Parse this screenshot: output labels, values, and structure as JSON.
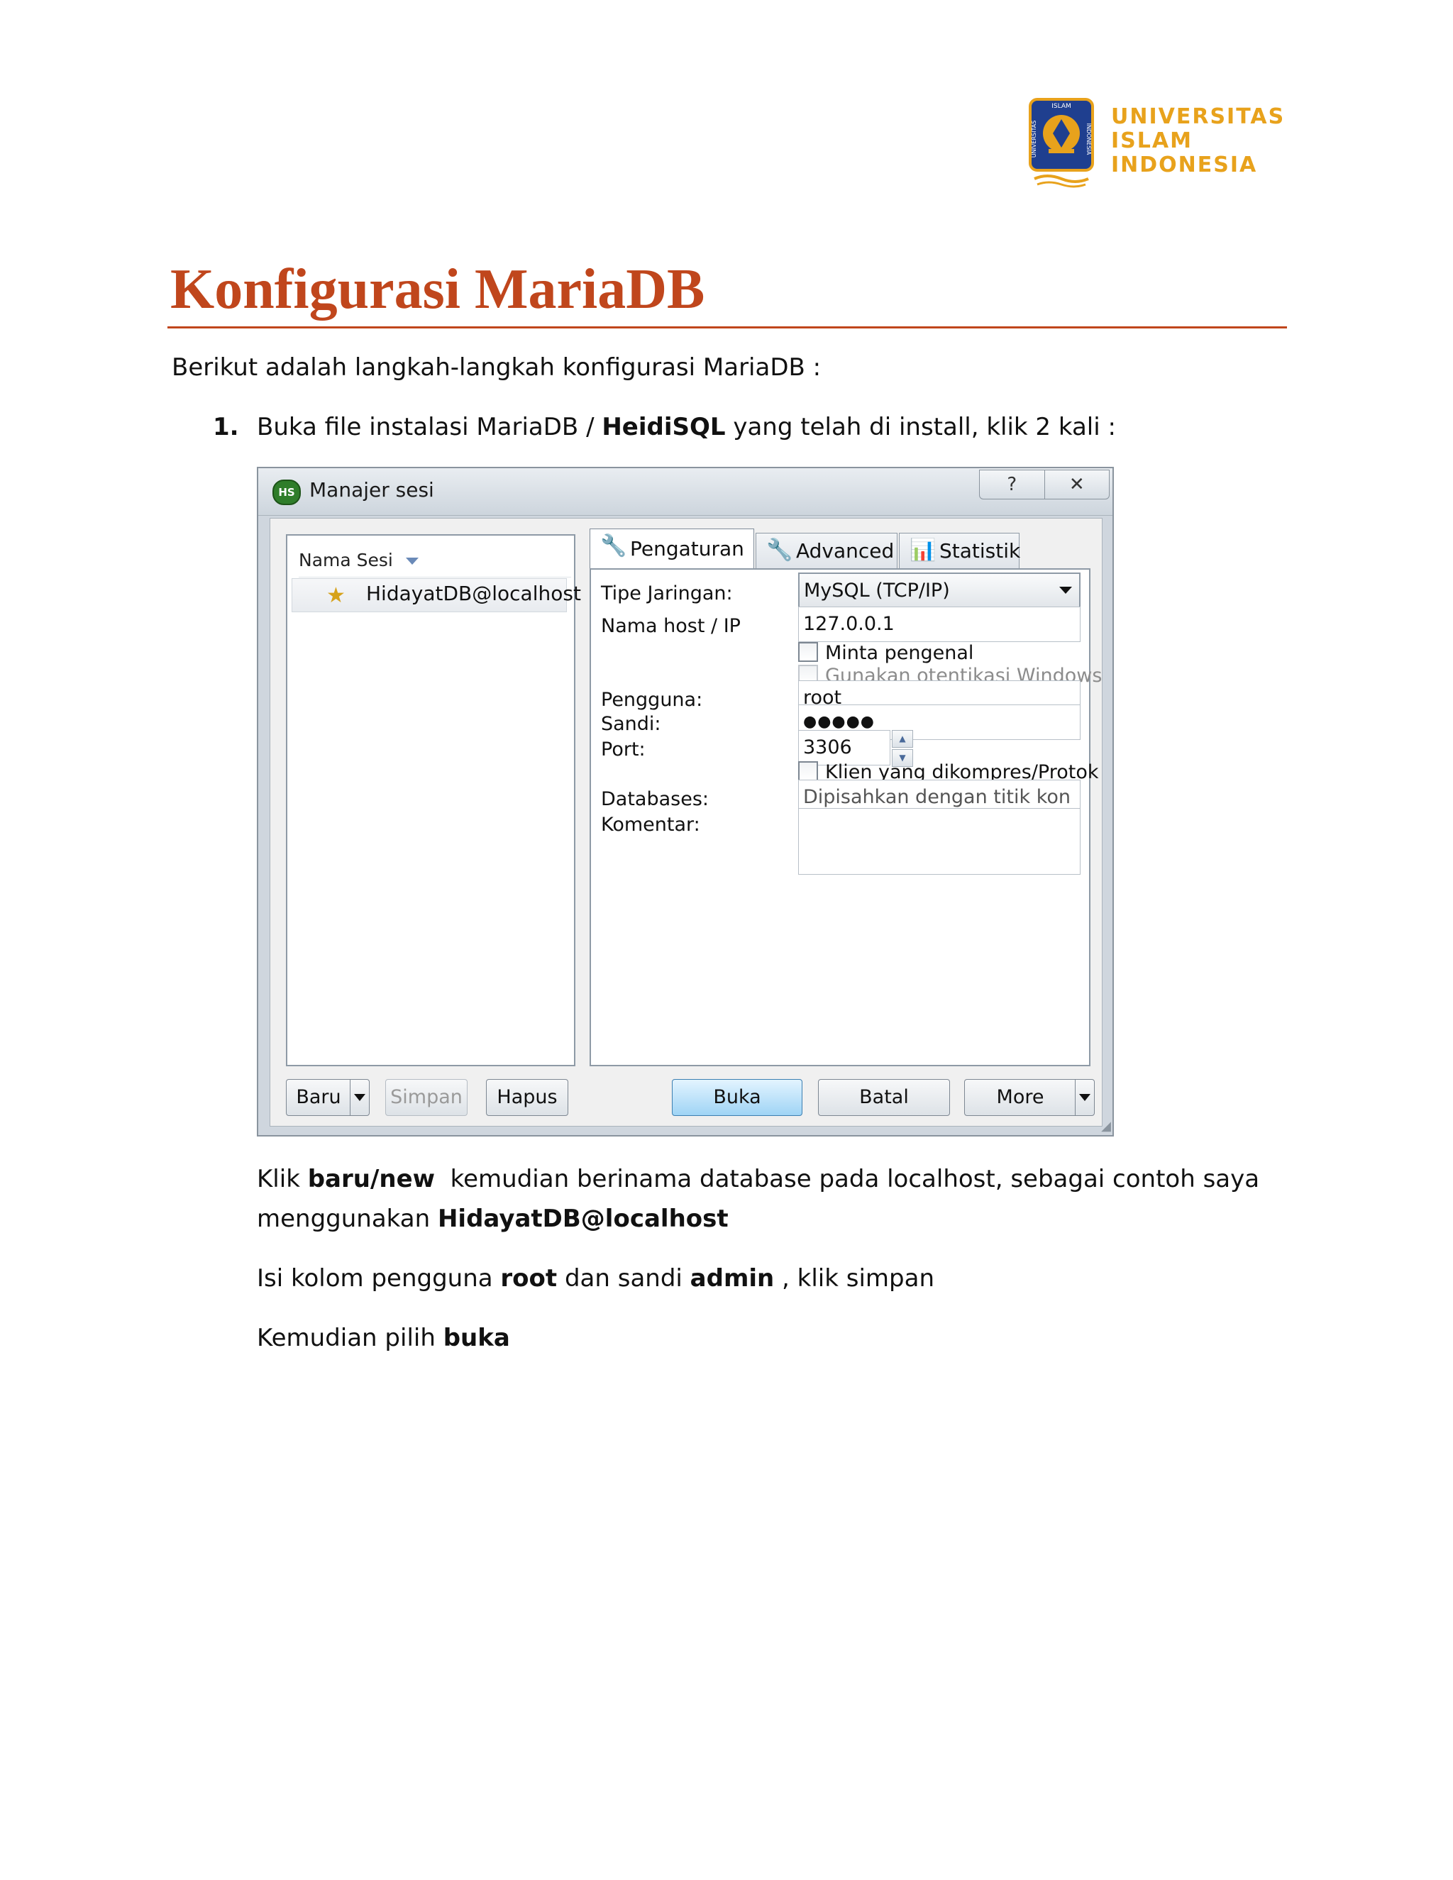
{
  "logo": {
    "line1": "UNIVERSITAS",
    "line2": "ISLAM",
    "line3": "INDONESIA",
    "emblem_text_top": "ISLAM",
    "emblem_text_left": "UNIVERSITAS",
    "emblem_text_right": "INDONESIA",
    "color": "#e8a21c",
    "emblem_color": "#1f3f8f"
  },
  "heading": {
    "title": "Konfigurasi MariaDB",
    "color": "#c0461c"
  },
  "intro": "Berikut adalah langkah-langkah konfigurasi MariaDB :",
  "step1": {
    "number": "1.",
    "text_before": "Buka file instalasi MariaDB / ",
    "bold": "HeidiSQL",
    "text_after": " yang telah di install, klik 2 kali :"
  },
  "dialog": {
    "app_icon": "HS",
    "title": "Manajer sesi",
    "help_button": "?",
    "close_button": "✕",
    "session_column": "Nama Sesi",
    "sessions": [
      "HidayatDB@localhost"
    ],
    "tabs": [
      {
        "label": "Pengaturan",
        "icon": "wrench-icon",
        "active": true
      },
      {
        "label": "Advanced",
        "icon": "wrench-icon",
        "active": false
      },
      {
        "label": "Statistik",
        "icon": "bar-chart-icon",
        "active": false
      }
    ],
    "fields": {
      "network_type_label": "Tipe Jaringan:",
      "network_type_value": "MySQL (TCP/IP)",
      "host_label": "Nama host / IP",
      "host_value": "127.0.0.1",
      "prompt_login_label": "Minta pengenal",
      "windows_auth_label": "Gunakan otentikasi Windows",
      "user_label": "Pengguna:",
      "user_value": "root",
      "password_label": "Sandi:",
      "password_value": "●●●●●",
      "port_label": "Port:",
      "port_value": "3306",
      "compressed_label": "Klien yang dikompres/Protok",
      "databases_label": "Databases:",
      "databases_placeholder": "Dipisahkan dengan titik kon",
      "comment_label": "Komentar:"
    },
    "buttons": {
      "new": "Baru",
      "save": "Simpan",
      "delete": "Hapus",
      "open": "Buka",
      "cancel": "Batal",
      "more": "More"
    }
  },
  "notes": {
    "p1_a": "Klik ",
    "p1_b": "baru/new",
    "p1_c": "  kemudian berinama database pada localhost, sebagai contoh saya",
    "p1_d": "menggunakan ",
    "p1_e": "HidayatDB@localhost",
    "p2_a": "Isi kolom pengguna ",
    "p2_b": "root",
    "p2_c": " dan sandi ",
    "p2_d": "admin",
    "p2_e": " , klik simpan",
    "p3_a": "Kemudian pilih ",
    "p3_b": "buka"
  }
}
